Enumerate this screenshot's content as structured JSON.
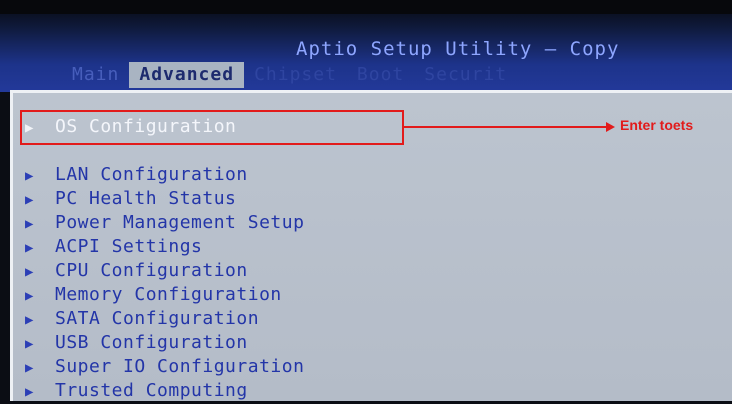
{
  "header": {
    "title": "Aptio Setup Utility – Copy"
  },
  "tabs": [
    {
      "label": "Main",
      "active": false
    },
    {
      "label": "Advanced",
      "active": true
    },
    {
      "label": "Chipset",
      "active": false
    },
    {
      "label": "Boot",
      "active": false
    },
    {
      "label": "Securit",
      "active": false
    }
  ],
  "menu": {
    "items": [
      {
        "label": "OS Configuration"
      },
      {
        "label": "LAN Configuration"
      },
      {
        "label": "PC Health Status"
      },
      {
        "label": "Power Management Setup"
      },
      {
        "label": "ACPI Settings"
      },
      {
        "label": "CPU Configuration"
      },
      {
        "label": "Memory Configuration"
      },
      {
        "label": "SATA Configuration"
      },
      {
        "label": "USB Configuration"
      },
      {
        "label": "Super IO Configuration"
      },
      {
        "label": "Trusted Computing"
      }
    ]
  },
  "annotation": {
    "text": "Enter toets",
    "color": "#e21b1b"
  },
  "colors": {
    "header_blue": "#1d338a",
    "panel_gray": "#bcc4cf",
    "menu_text": "#2335a8"
  },
  "icons": {
    "submenu": "triangle-right-icon"
  }
}
